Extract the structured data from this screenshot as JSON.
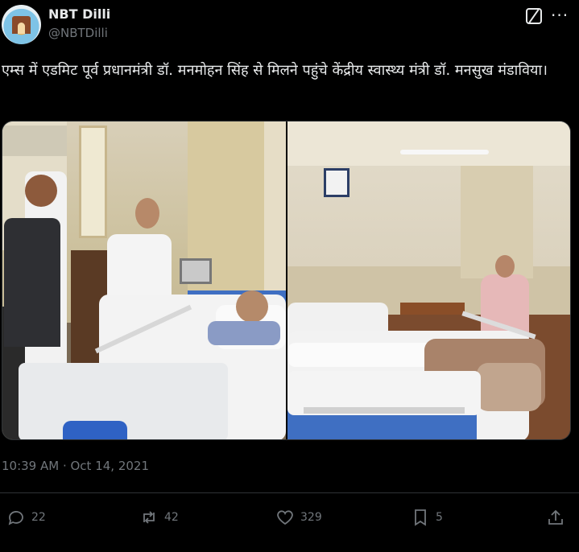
{
  "account": {
    "name": "NBT Dilli",
    "handle": "@NBTDilli",
    "avatar_icon": "india-gate-avatar"
  },
  "header_icons": [
    "grok-icon",
    "more-icon"
  ],
  "tweet": {
    "text": "एम्स में एडमिट पूर्व प्रधानमंत्री डॉ. मनमोहन सिंह से मिलने पहुंचे केंद्रीय स्वास्थ्य मंत्री डॉ. मनसुख मंडाविया।",
    "timestamp": "10:39 AM · Oct 14, 2021"
  },
  "media": {
    "photo_count": 2
  },
  "actions": {
    "replies": "22",
    "reposts": "42",
    "likes": "329",
    "bookmarks": "5"
  },
  "colors": {
    "background": "#000000",
    "text": "#e7e9ea",
    "muted": "#71767b",
    "border": "#2f3336"
  }
}
